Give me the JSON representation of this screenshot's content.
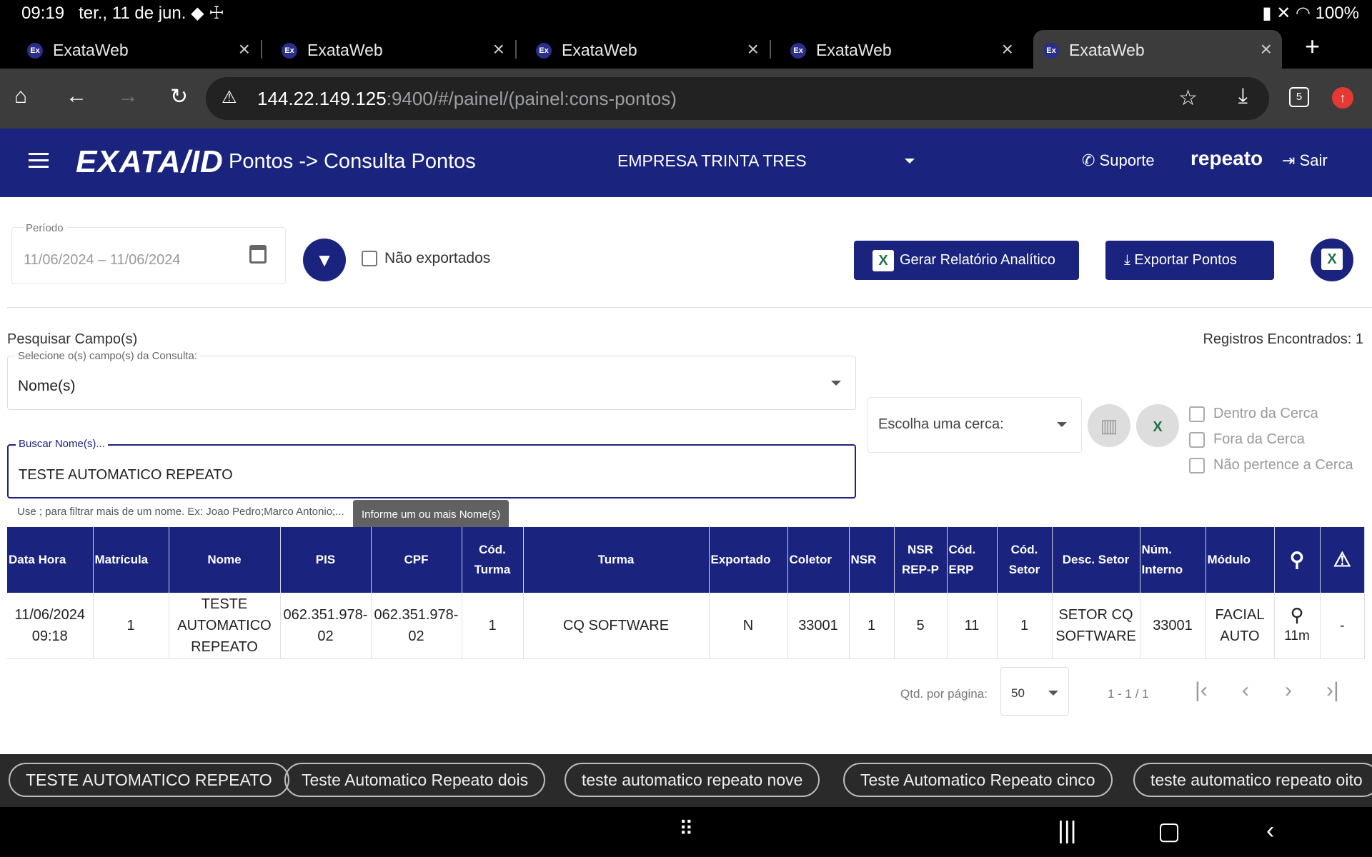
{
  "status": {
    "time": "09:19",
    "date": "ter., 11 de jun.",
    "battery": "100%"
  },
  "browser": {
    "tabs": [
      {
        "title": "ExataWeb"
      },
      {
        "title": "ExataWeb"
      },
      {
        "title": "ExataWeb"
      },
      {
        "title": "ExataWeb"
      },
      {
        "title": "ExataWeb"
      }
    ],
    "url_host": "144.22.149.125",
    "url_rest": ":9400/#/painel/(painel:cons-pontos)",
    "tab_count": "5"
  },
  "app": {
    "logo": "EXATA/ID",
    "title": "Pontos -> Consulta Pontos",
    "company": "EMPRESA TRINTA TRES",
    "suporte": "Suporte",
    "user": "repeato",
    "sair": "Sair"
  },
  "filters": {
    "periodo_label": "Período",
    "periodo_value": "11/06/2024 – 11/06/2024",
    "nao_exportados": "Não exportados",
    "gerar_relatorio": "Gerar Relatório Analítico",
    "exportar_pontos": "Exportar Pontos"
  },
  "search": {
    "title": "Pesquisar Campo(s)",
    "registros": "Registros Encontrados: 1",
    "select_label": "Selecione o(s) campo(s) da Consulta:",
    "select_value": "Nome(s)",
    "input_label": "Buscar Nome(s)...",
    "input_value": "TESTE AUTOMATICO REPEATO",
    "hint": "Use ; para filtrar mais de um nome. Ex: Joao Pedro;Marco Antonio;...",
    "tooltip": "Informe um ou mais Nome(s)"
  },
  "cerca": {
    "placeholder": "Escolha uma cerca:",
    "dentro": "Dentro da Cerca",
    "fora": "Fora da Cerca",
    "nao_pertence": "Não pertence a Cerca"
  },
  "table": {
    "headers": [
      "Data Hora",
      "Matrícula",
      "Nome",
      "PIS",
      "CPF",
      "Cód. Turma",
      "Turma",
      "Exportado",
      "Coletor",
      "NSR",
      "NSR REP-P",
      "Cód. ERP",
      "Cód. Setor",
      "Desc. Setor",
      "Núm. Interno",
      "Módulo"
    ],
    "row": {
      "data_hora": "11/06/2024 09:18",
      "matricula": "1",
      "nome": "TESTE AUTOMATICO REPEATO",
      "pis": "062.351.978-02",
      "cpf": "062.351.978-02",
      "cod_turma": "1",
      "turma": "CQ SOFTWARE",
      "exportado": "N",
      "coletor": "33001",
      "nsr": "1",
      "nsr_rep_p": "5",
      "cod_erp": "11",
      "cod_setor": "1",
      "desc_setor": "SETOR CQ SOFTWARE",
      "num_interno": "33001",
      "modulo": "FACIAL AUTO",
      "distance": "11m",
      "alert": "-"
    }
  },
  "pager": {
    "qtd_label": "Qtd. por página:",
    "qtd_value": "50",
    "range": "1 - 1 / 1"
  },
  "chips": [
    "TESTE AUTOMATICO REPEATO",
    "Teste Automatico Repeato dois",
    "teste automatico repeato nove",
    "Teste Automatico Repeato cinco",
    "teste automatico repeato oito"
  ]
}
